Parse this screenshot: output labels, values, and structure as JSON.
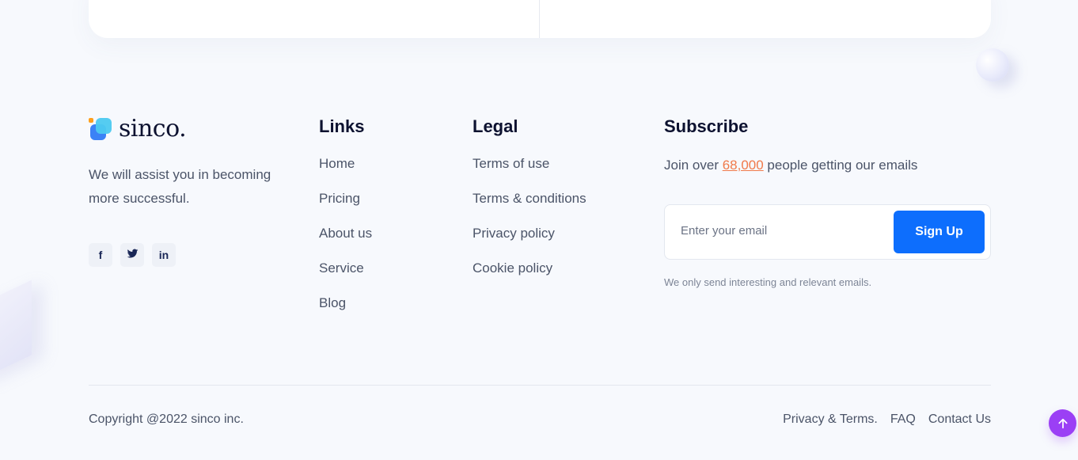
{
  "brand": {
    "name": "sinco.",
    "tagline": "We will assist you in becoming more successful."
  },
  "socials": [
    {
      "icon": "facebook-icon",
      "label": "f"
    },
    {
      "icon": "twitter-icon"
    },
    {
      "icon": "linkedin-icon",
      "label": "in"
    }
  ],
  "links": {
    "title": "Links",
    "items": [
      "Home",
      "Pricing",
      "About us",
      "Service",
      "Blog"
    ]
  },
  "legal": {
    "title": "Legal",
    "items": [
      "Terms of use",
      "Terms & conditions",
      "Privacy policy",
      "Cookie policy"
    ]
  },
  "subscribe": {
    "title": "Subscribe",
    "text_before": "Join over ",
    "count": "68,000",
    "text_after": " people getting our emails",
    "email_placeholder": "Enter your email",
    "button_label": "Sign Up",
    "note": "We only send interesting and relevant emails."
  },
  "footer": {
    "copyright": "Copyright @2022 sinco inc.",
    "links": [
      "Privacy & Terms.",
      "FAQ",
      "Contact Us"
    ]
  },
  "colors": {
    "accent": "#0d6efd",
    "highlight": "#f07a4a",
    "scroll_button": "#9b3ff5"
  }
}
